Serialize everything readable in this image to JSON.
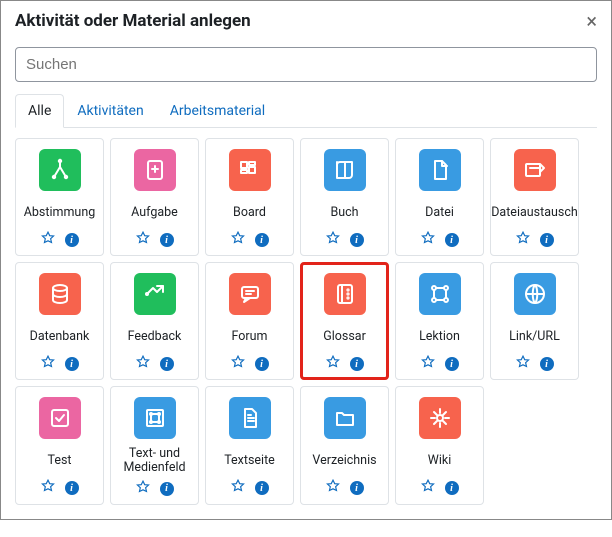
{
  "dialog": {
    "title": "Aktivität oder Material anlegen",
    "close_label": "×"
  },
  "search": {
    "placeholder": "Suchen"
  },
  "tabs": [
    {
      "label": "Alle",
      "active": true
    },
    {
      "label": "Aktivitäten",
      "active": false
    },
    {
      "label": "Arbeitsmaterial",
      "active": false
    }
  ],
  "colors": {
    "green": "#20be5c",
    "pink": "#eb66a2",
    "orange": "#f7634d",
    "blue": "#399be2"
  },
  "activities": [
    {
      "label": "Abstimmung",
      "icon": "choice-icon",
      "color": "green",
      "highlight": false
    },
    {
      "label": "Aufgabe",
      "icon": "assign-icon",
      "color": "pink",
      "highlight": false
    },
    {
      "label": "Board",
      "icon": "board-icon",
      "color": "orange",
      "highlight": false
    },
    {
      "label": "Buch",
      "icon": "book-icon",
      "color": "blue",
      "highlight": false
    },
    {
      "label": "Datei",
      "icon": "file-icon",
      "color": "blue",
      "highlight": false
    },
    {
      "label": "Dateiaustausch",
      "icon": "fileexch-icon",
      "color": "orange",
      "highlight": false
    },
    {
      "label": "Datenbank",
      "icon": "database-icon",
      "color": "orange",
      "highlight": false
    },
    {
      "label": "Feedback",
      "icon": "feedback-icon",
      "color": "green",
      "highlight": false
    },
    {
      "label": "Forum",
      "icon": "forum-icon",
      "color": "orange",
      "highlight": false
    },
    {
      "label": "Glossar",
      "icon": "glossary-icon",
      "color": "orange",
      "highlight": true
    },
    {
      "label": "Lektion",
      "icon": "lesson-icon",
      "color": "blue",
      "highlight": false
    },
    {
      "label": "Link/URL",
      "icon": "url-icon",
      "color": "blue",
      "highlight": false
    },
    {
      "label": "Test",
      "icon": "quiz-icon",
      "color": "pink",
      "highlight": false
    },
    {
      "label": "Text- und Medienfeld",
      "icon": "label-icon",
      "color": "blue",
      "highlight": false
    },
    {
      "label": "Textseite",
      "icon": "page-icon",
      "color": "blue",
      "highlight": false
    },
    {
      "label": "Verzeichnis",
      "icon": "folder-icon",
      "color": "blue",
      "highlight": false
    },
    {
      "label": "Wiki",
      "icon": "wiki-icon",
      "color": "orange",
      "highlight": false
    }
  ],
  "info_glyph": "i"
}
